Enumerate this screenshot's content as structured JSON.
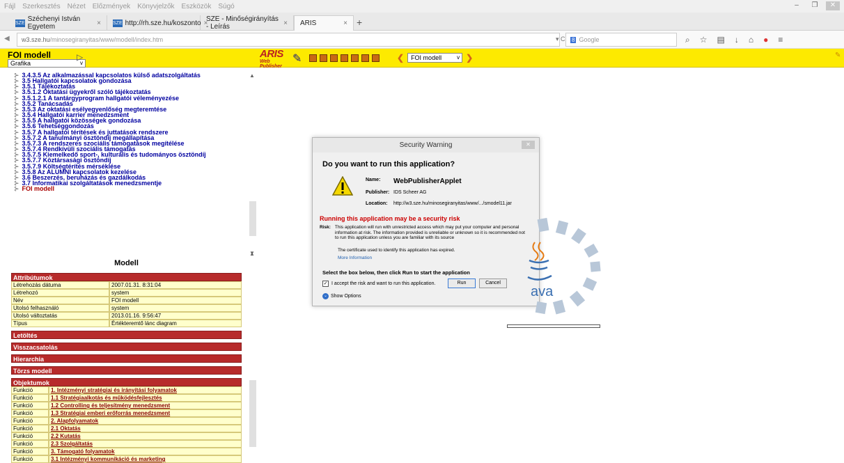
{
  "menubar": {
    "items": [
      "Fájl",
      "Szerkesztés",
      "Nézet",
      "Előzmények",
      "Könyvjelzők",
      "Eszközök",
      "Súgó"
    ]
  },
  "tabs": [
    {
      "label": "Széchenyi István Egyetem",
      "close": "×"
    },
    {
      "label": "http://rh.sze.hu/koszonto",
      "close": "×"
    },
    {
      "label": "SZE - Minőségirányítás - Leírás",
      "close": "×"
    },
    {
      "label": "ARIS",
      "close": "×"
    }
  ],
  "newtab": "+",
  "nav": {
    "url_host": "w3.sze.hu",
    "url_path": "/minosegiranyitas/www/modell/index.htm",
    "search_placeholder": "Google",
    "search_engine": "8"
  },
  "aris": {
    "title": "FOI modell",
    "view_select": "Grafika",
    "logo_main": "ARIS",
    "logo_sub": "Web Publisher",
    "model_select": "FOI modell"
  },
  "tree": {
    "items": [
      "3.4.3.5 Az alkalmazással kapcsolatos külső adatszolgáltatás",
      "3.5 Hallgatói kapcsolatok gondozása",
      "3.5.1 Tájékoztatás",
      "3.5.1.2 Oktatási ügyekről szóló tájékoztatás",
      "3.5.1.2.1 A tantárgyprogram hallgatói véleményezése",
      "3.5.2 Tanácsadás",
      "3.5.3 Az oktatási esélyegyenlőség megteremtése",
      "3.5.4 Hallgatói karrier menedzsment",
      "3.5.5 A hallgatói közösségek gondozása",
      "3.5.6 Tehetséggondozás",
      "3.5.7 A hallgatói térítések és juttatások rendszere",
      "3.5.7.2 A tanulmányi ösztöndíj megállapítása",
      "3.5.7.3 A rendszeres szociális támogatások megítélése",
      "3.5.7.4 Rendkívüli szociális támogatás",
      "3.5.7.5 Kiemelkedő sport-, kulturális és tudományos ösztöndíj",
      "3.5.7.7 Köztársasági ösztöndíj",
      "3.5.7.9 Költségtérítés mérséklése",
      "3.5.8 Az ALUMNI kapcsolatok kezelése",
      "3.6 Beszerzés, beruházás és gazdálkodás",
      "3.7 Informatikai szolgáltatások menedzsmentje",
      "FOI modell"
    ]
  },
  "props": {
    "title": "Modell",
    "attr_header": "Attribútumok",
    "attrs": [
      {
        "k": "Létrehozás dátuma",
        "v": "2007.01.31. 8:31:04"
      },
      {
        "k": "Létrehozó",
        "v": "system"
      },
      {
        "k": "Név",
        "v": "FOI modell"
      },
      {
        "k": "Utolsó felhasználó",
        "v": "system"
      },
      {
        "k": "Utolsó változtatás",
        "v": "2013.01.16. 9:56:47"
      },
      {
        "k": "Típus",
        "v": "Értékteremtő lánc diagram"
      }
    ],
    "sections": [
      "Letöltés",
      "Visszacsatolás",
      "Hierarchia",
      "Törzs modell"
    ],
    "obj_header": "Objektumok",
    "objects": [
      {
        "k": "Funkció",
        "v": "1. Intézményi stratégiai és irányítási folyamatok"
      },
      {
        "k": "Funkció",
        "v": "1.1 Stratégiaalkotás és működésfejlesztés"
      },
      {
        "k": "Funkció",
        "v": "1.2 Controlling és teljesítmény menedzsment"
      },
      {
        "k": "Funkció",
        "v": "1.3 Stratégiai emberi erőforrás menedzsment"
      },
      {
        "k": "Funkció",
        "v": "2. Alapfolyamatok"
      },
      {
        "k": "Funkció",
        "v": "2.1 Oktatás"
      },
      {
        "k": "Funkció",
        "v": "2.2 Kutatás"
      },
      {
        "k": "Funkció",
        "v": "2.3 Szolgáltatás"
      },
      {
        "k": "Funkció",
        "v": "3. Támogató folyamatok"
      },
      {
        "k": "Funkció",
        "v": "3.1 Intézményi kommunikáció és marketing"
      }
    ]
  },
  "dialog": {
    "title": "Security Warning",
    "question": "Do you want to run this application?",
    "name_label": "Name:",
    "name_value": "WebPublisherApplet",
    "publisher_label": "Publisher:",
    "publisher_value": "IDS Scheer AG",
    "location_label": "Location:",
    "location_value": "http://w3.sze.hu/minosegiranyitas/www/.../smodel11.jar",
    "risk_headline": "Running this application may be a security risk",
    "risk_label": "Risk:",
    "risk_text": "This application will run with unrestricted access which may put your computer and personal information at risk. The information provided is unreliable or unknown so it is recommended not to run this application unless you are familiar with its source",
    "cert_text": "The certificate used to identify this application has expired.",
    "more_info": "More Information",
    "select_text": "Select the box below, then click Run to start the application",
    "accept_text": "I accept the risk and want to run this application.",
    "run_label": "Run",
    "cancel_label": "Cancel",
    "show_options": "Show Options"
  },
  "java": {
    "text": "ava"
  },
  "colors": {
    "aris_yellow": "#fdea00",
    "section_red": "#b72b2b",
    "tree_blue": "#0000a0",
    "risk_red": "#c00000"
  }
}
